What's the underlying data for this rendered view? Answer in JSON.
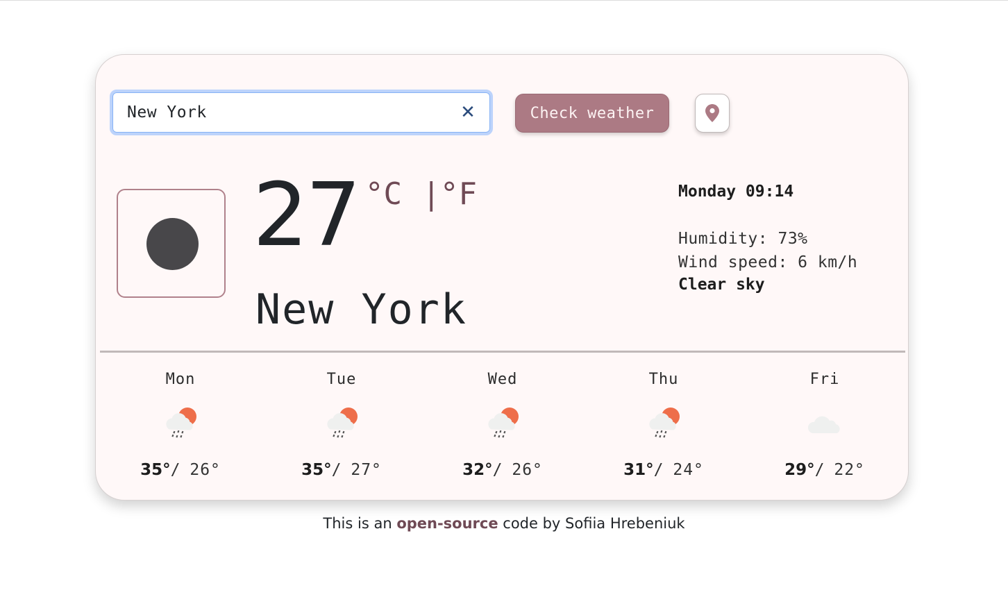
{
  "search": {
    "value": "New York",
    "clear_icon": "close-icon"
  },
  "buttons": {
    "check_weather": "Check weather",
    "location_icon": "map-pin-icon"
  },
  "current": {
    "icon": "moon-clear-night-icon",
    "temperature": "27",
    "unit_celsius": "°C",
    "unit_separator": "|",
    "unit_fahrenheit": "°F",
    "city": "New York",
    "datetime": "Monday 09:14",
    "humidity": "Humidity: 73%",
    "wind": "Wind speed: 6 km/h",
    "description": "Clear sky"
  },
  "forecast": [
    {
      "day": "Mon",
      "icon": "sun-cloud-rain-icon",
      "max": "35°",
      "sep": "/",
      "min": "26°"
    },
    {
      "day": "Tue",
      "icon": "sun-cloud-rain-icon",
      "max": "35°",
      "sep": "/",
      "min": "27°"
    },
    {
      "day": "Wed",
      "icon": "sun-cloud-rain-icon",
      "max": "32°",
      "sep": "/",
      "min": "26°"
    },
    {
      "day": "Thu",
      "icon": "sun-cloud-rain-icon",
      "max": "31°",
      "sep": "/",
      "min": "24°"
    },
    {
      "day": "Fri",
      "icon": "cloud-icon",
      "max": "29°",
      "sep": "/",
      "min": "22°"
    }
  ],
  "footer": {
    "prefix": "This is an ",
    "link": "open-source",
    "suffix": " code by Sofiia Hrebeniuk"
  },
  "colors": {
    "accent": "#ac7a84",
    "accent_dark": "#6f4a55",
    "card_bg": "#fff8f8",
    "sun": "#ee6e4a",
    "cloud": "#eff0ef"
  }
}
